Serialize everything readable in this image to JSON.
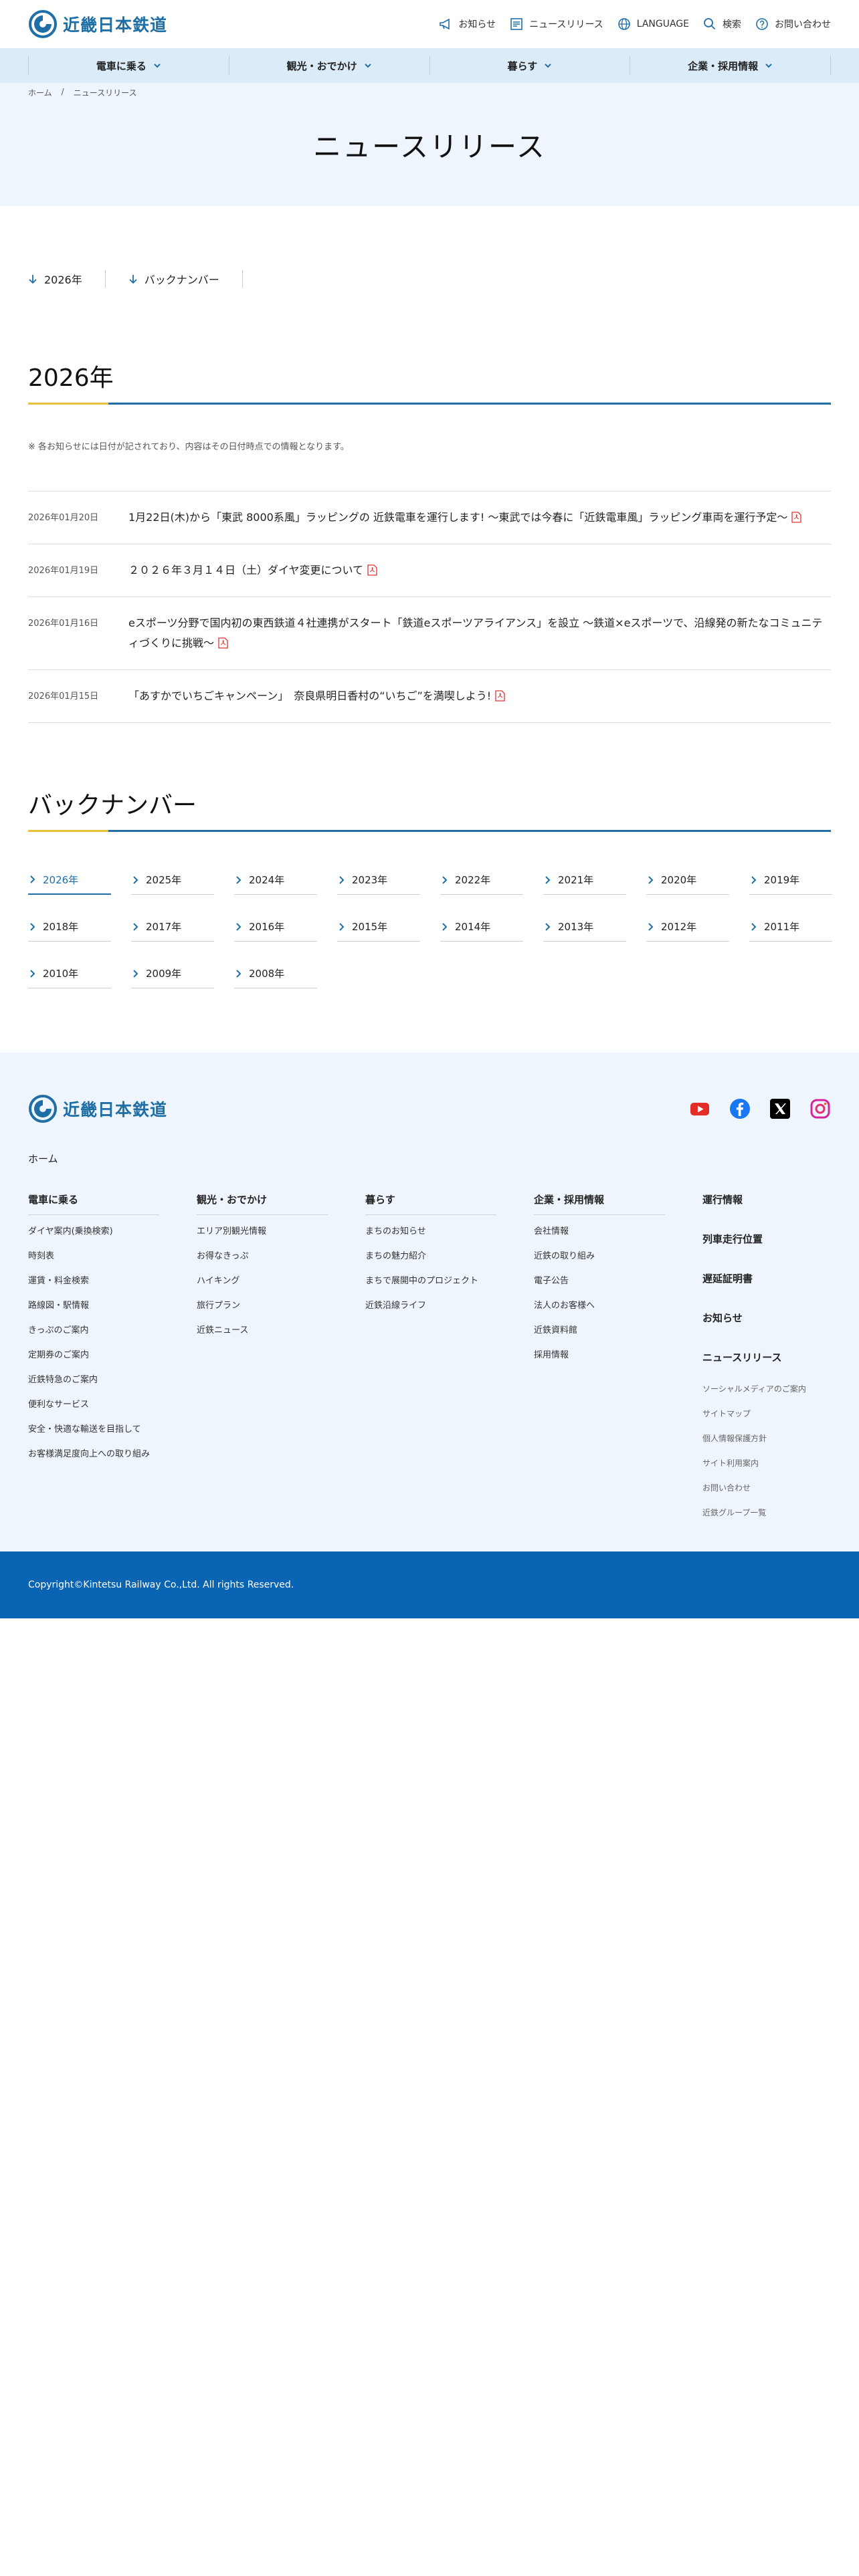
{
  "brand": {
    "name": "近畿日本鉄道",
    "color": "#1f6fa6"
  },
  "utility_nav": [
    {
      "label": "お知らせ",
      "icon": "megaphone-icon"
    },
    {
      "label": "ニュースリリース",
      "icon": "newspaper-icon"
    },
    {
      "label": "LANGUAGE",
      "icon": "globe-icon"
    },
    {
      "label": "検索",
      "icon": "search-icon"
    },
    {
      "label": "お問い合わせ",
      "icon": "question-icon"
    }
  ],
  "global_nav": [
    "電車に乗る",
    "観光・おでかけ",
    "暮らす",
    "企業・採用情報"
  ],
  "breadcrumb": [
    "ホーム",
    "/",
    "ニュースリリース"
  ],
  "page_title": "ニュースリリース",
  "anchors": [
    "2026年",
    "バックナンバー"
  ],
  "section_year": "2026年",
  "note": "※ 各お知らせには日付が記されており、内容はその日付時点での情報となります。",
  "news": [
    {
      "date": "2026年01月20日",
      "text": "1月22日(木)から「東武 8000系風」ラッピングの 近鉄電車を運行します! ～東武では今春に「近鉄電車風」ラッピング車両を運行予定～"
    },
    {
      "date": "2026年01月19日",
      "text": "２０２６年３月１４日（土）ダイヤ変更について"
    },
    {
      "date": "2026年01月16日",
      "text": "eスポーツ分野で国内初の東西鉄道４社連携がスタート「鉄道eスポーツアライアンス」を設立 ～鉄道×eスポーツで、沿線発の新たなコミュニティづくりに挑戦～"
    },
    {
      "date": "2026年01月15日",
      "text": "「あすかでいちごキャンペーン」　奈良県明日香村の“いちご”を満喫しよう!"
    }
  ],
  "section_backnumber": "バックナンバー",
  "years": [
    "2026年",
    "2025年",
    "2024年",
    "2023年",
    "2022年",
    "2021年",
    "2020年",
    "2019年",
    "2018年",
    "2017年",
    "2016年",
    "2015年",
    "2014年",
    "2013年",
    "2012年",
    "2011年",
    "2010年",
    "2009年",
    "2008年"
  ],
  "footer": {
    "home": "ホーム",
    "social": [
      "youtube-icon",
      "facebook-icon",
      "x-icon",
      "instagram-icon"
    ],
    "columns": [
      {
        "title": "電車に乗る",
        "links": [
          "ダイヤ案内(乗換検索)",
          "時刻表",
          "運賃・料金検索",
          "路線図・駅情報",
          "きっぷのご案内",
          "定期券のご案内",
          "近鉄特急のご案内",
          "便利なサービス",
          "安全・快適な輸送を目指して",
          "お客様満足度向上への取り組み"
        ]
      },
      {
        "title": "観光・おでかけ",
        "links": [
          "エリア別観光情報",
          "お得なきっぷ",
          "ハイキング",
          "旅行プラン",
          "近鉄ニュース"
        ]
      },
      {
        "title": "暮らす",
        "links": [
          "まちのお知らせ",
          "まちの魅力紹介",
          "まちで展開中のプロジェクト",
          "近鉄沿線ライフ"
        ]
      },
      {
        "title": "企業・採用情報",
        "links": [
          "会社情報",
          "近鉄の取り組み",
          "電子公告",
          "法人のお客様へ",
          "近鉄資料館",
          "採用情報"
        ]
      }
    ],
    "last_big": [
      "運行情報",
      "列車走行位置",
      "遅延証明書",
      "お知らせ",
      "ニュースリリース"
    ],
    "last_small": [
      "ソーシャルメディアのご案内",
      "サイトマップ",
      "個人情報保護方針",
      "サイト利用案内",
      "お問い合わせ",
      "近鉄グループ一覧"
    ]
  },
  "copyright": "Copyright©Kintetsu Railway Co.,Ltd. All rights Reserved."
}
